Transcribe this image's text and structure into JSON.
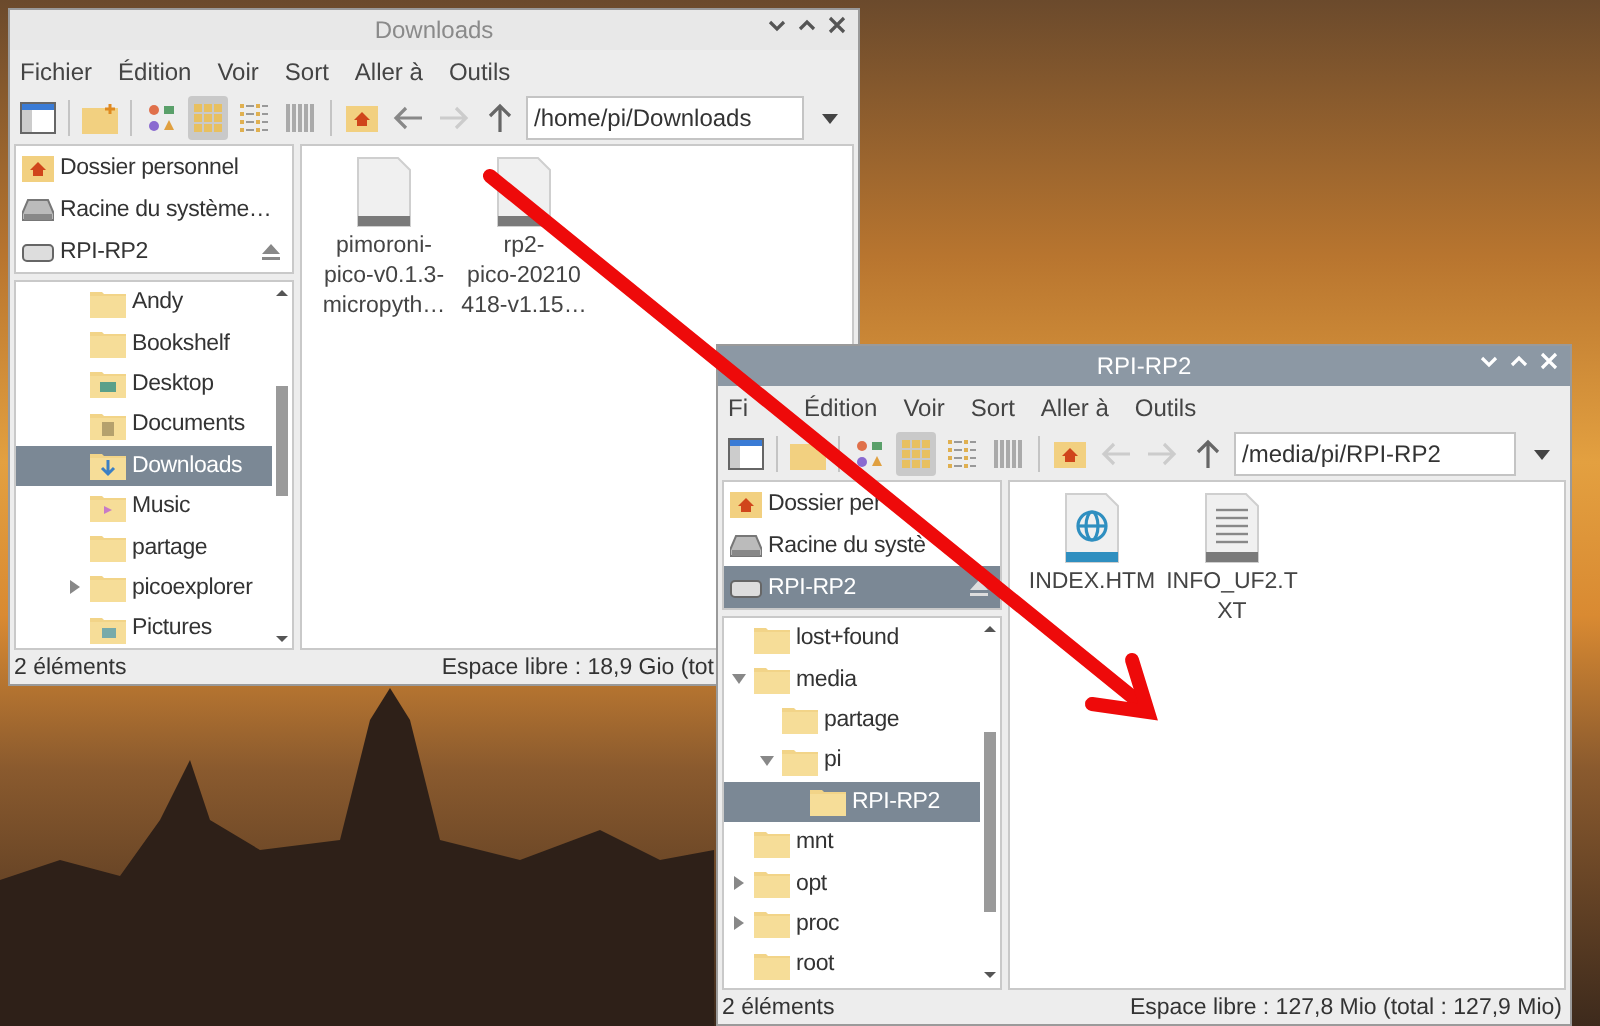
{
  "windows": [
    {
      "title": "Downloads",
      "active": false,
      "menu": [
        "Fichier",
        "Édition",
        "Voir",
        "Sort",
        "Aller à",
        "Outils"
      ],
      "view_modes": [
        {
          "selected": false
        },
        {
          "selected": true
        },
        {
          "selected": false
        },
        {
          "selected": false
        }
      ],
      "back_disabled": false,
      "forward_disabled": true,
      "path": "/home/pi/Downloads",
      "places": [
        {
          "label": "Dossier personnel",
          "kind": "home",
          "selected": false
        },
        {
          "label": "Racine du système…",
          "kind": "drive",
          "selected": false
        },
        {
          "label": "RPI-RP2",
          "kind": "usb",
          "selected": false,
          "eject": true
        }
      ],
      "tree": [
        {
          "label": "Andy",
          "kind": "folder",
          "selected": false
        },
        {
          "label": "Bookshelf",
          "kind": "folder",
          "selected": false
        },
        {
          "label": "Desktop",
          "kind": "desktop",
          "selected": false
        },
        {
          "label": "Documents",
          "kind": "documents",
          "selected": false
        },
        {
          "label": "Downloads",
          "kind": "downloads",
          "selected": true
        },
        {
          "label": "Music",
          "kind": "music",
          "selected": false
        },
        {
          "label": "partage",
          "kind": "folder",
          "selected": false
        },
        {
          "label": "picoexplorer",
          "kind": "folder",
          "selected": false,
          "expanded": false
        },
        {
          "label": "Pictures",
          "kind": "pictures",
          "selected": false
        }
      ],
      "files": [
        {
          "lines": [
            "pimoroni-",
            "pico-v0.1.3-",
            "micropyth…"
          ],
          "kind": "blank"
        },
        {
          "lines": [
            "rp2-",
            "pico-20210",
            "418-v1.15…"
          ],
          "kind": "blank"
        }
      ],
      "status_left": "2 éléments",
      "status_right": "Espace libre : 18,9 Gio (tot"
    },
    {
      "title": "RPI-RP2",
      "active": true,
      "menu": [
        "Fi",
        "Édition",
        "Voir",
        "Sort",
        "Aller à",
        "Outils"
      ],
      "view_modes": [
        {
          "selected": false
        },
        {
          "selected": true
        },
        {
          "selected": false
        },
        {
          "selected": false
        }
      ],
      "back_disabled": true,
      "forward_disabled": true,
      "path": "/media/pi/RPI-RP2",
      "places": [
        {
          "label": "Dossier per",
          "kind": "home",
          "selected": false
        },
        {
          "label": "Racine du systè",
          "kind": "drive",
          "selected": false
        },
        {
          "label": "RPI-RP2",
          "kind": "usb",
          "selected": true,
          "eject": true
        }
      ],
      "tree": [
        {
          "label": "lost+found",
          "kind": "folder",
          "selected": false
        },
        {
          "label": "media",
          "kind": "folder",
          "selected": false,
          "expanded": true,
          "children": [
            {
              "label": "partage",
              "kind": "folder",
              "selected": false
            },
            {
              "label": "pi",
              "kind": "folder",
              "selected": false,
              "expanded": true,
              "children": [
                {
                  "label": "RPI-RP2",
                  "kind": "folder",
                  "selected": true
                }
              ]
            }
          ]
        },
        {
          "label": "mnt",
          "kind": "folder",
          "selected": false
        },
        {
          "label": "opt",
          "kind": "folder",
          "selected": false,
          "expanded": false
        },
        {
          "label": "proc",
          "kind": "folder",
          "selected": false,
          "expanded": false
        },
        {
          "label": "root",
          "kind": "folder",
          "selected": false
        }
      ],
      "files": [
        {
          "lines": [
            "INDEX.HTM"
          ],
          "kind": "html"
        },
        {
          "lines": [
            "INFO_UF2.T",
            "XT"
          ],
          "kind": "text"
        }
      ],
      "status_left": "2 éléments",
      "status_right": "Espace libre : 127,8 Mio (total : 127,9 Mio)"
    }
  ]
}
